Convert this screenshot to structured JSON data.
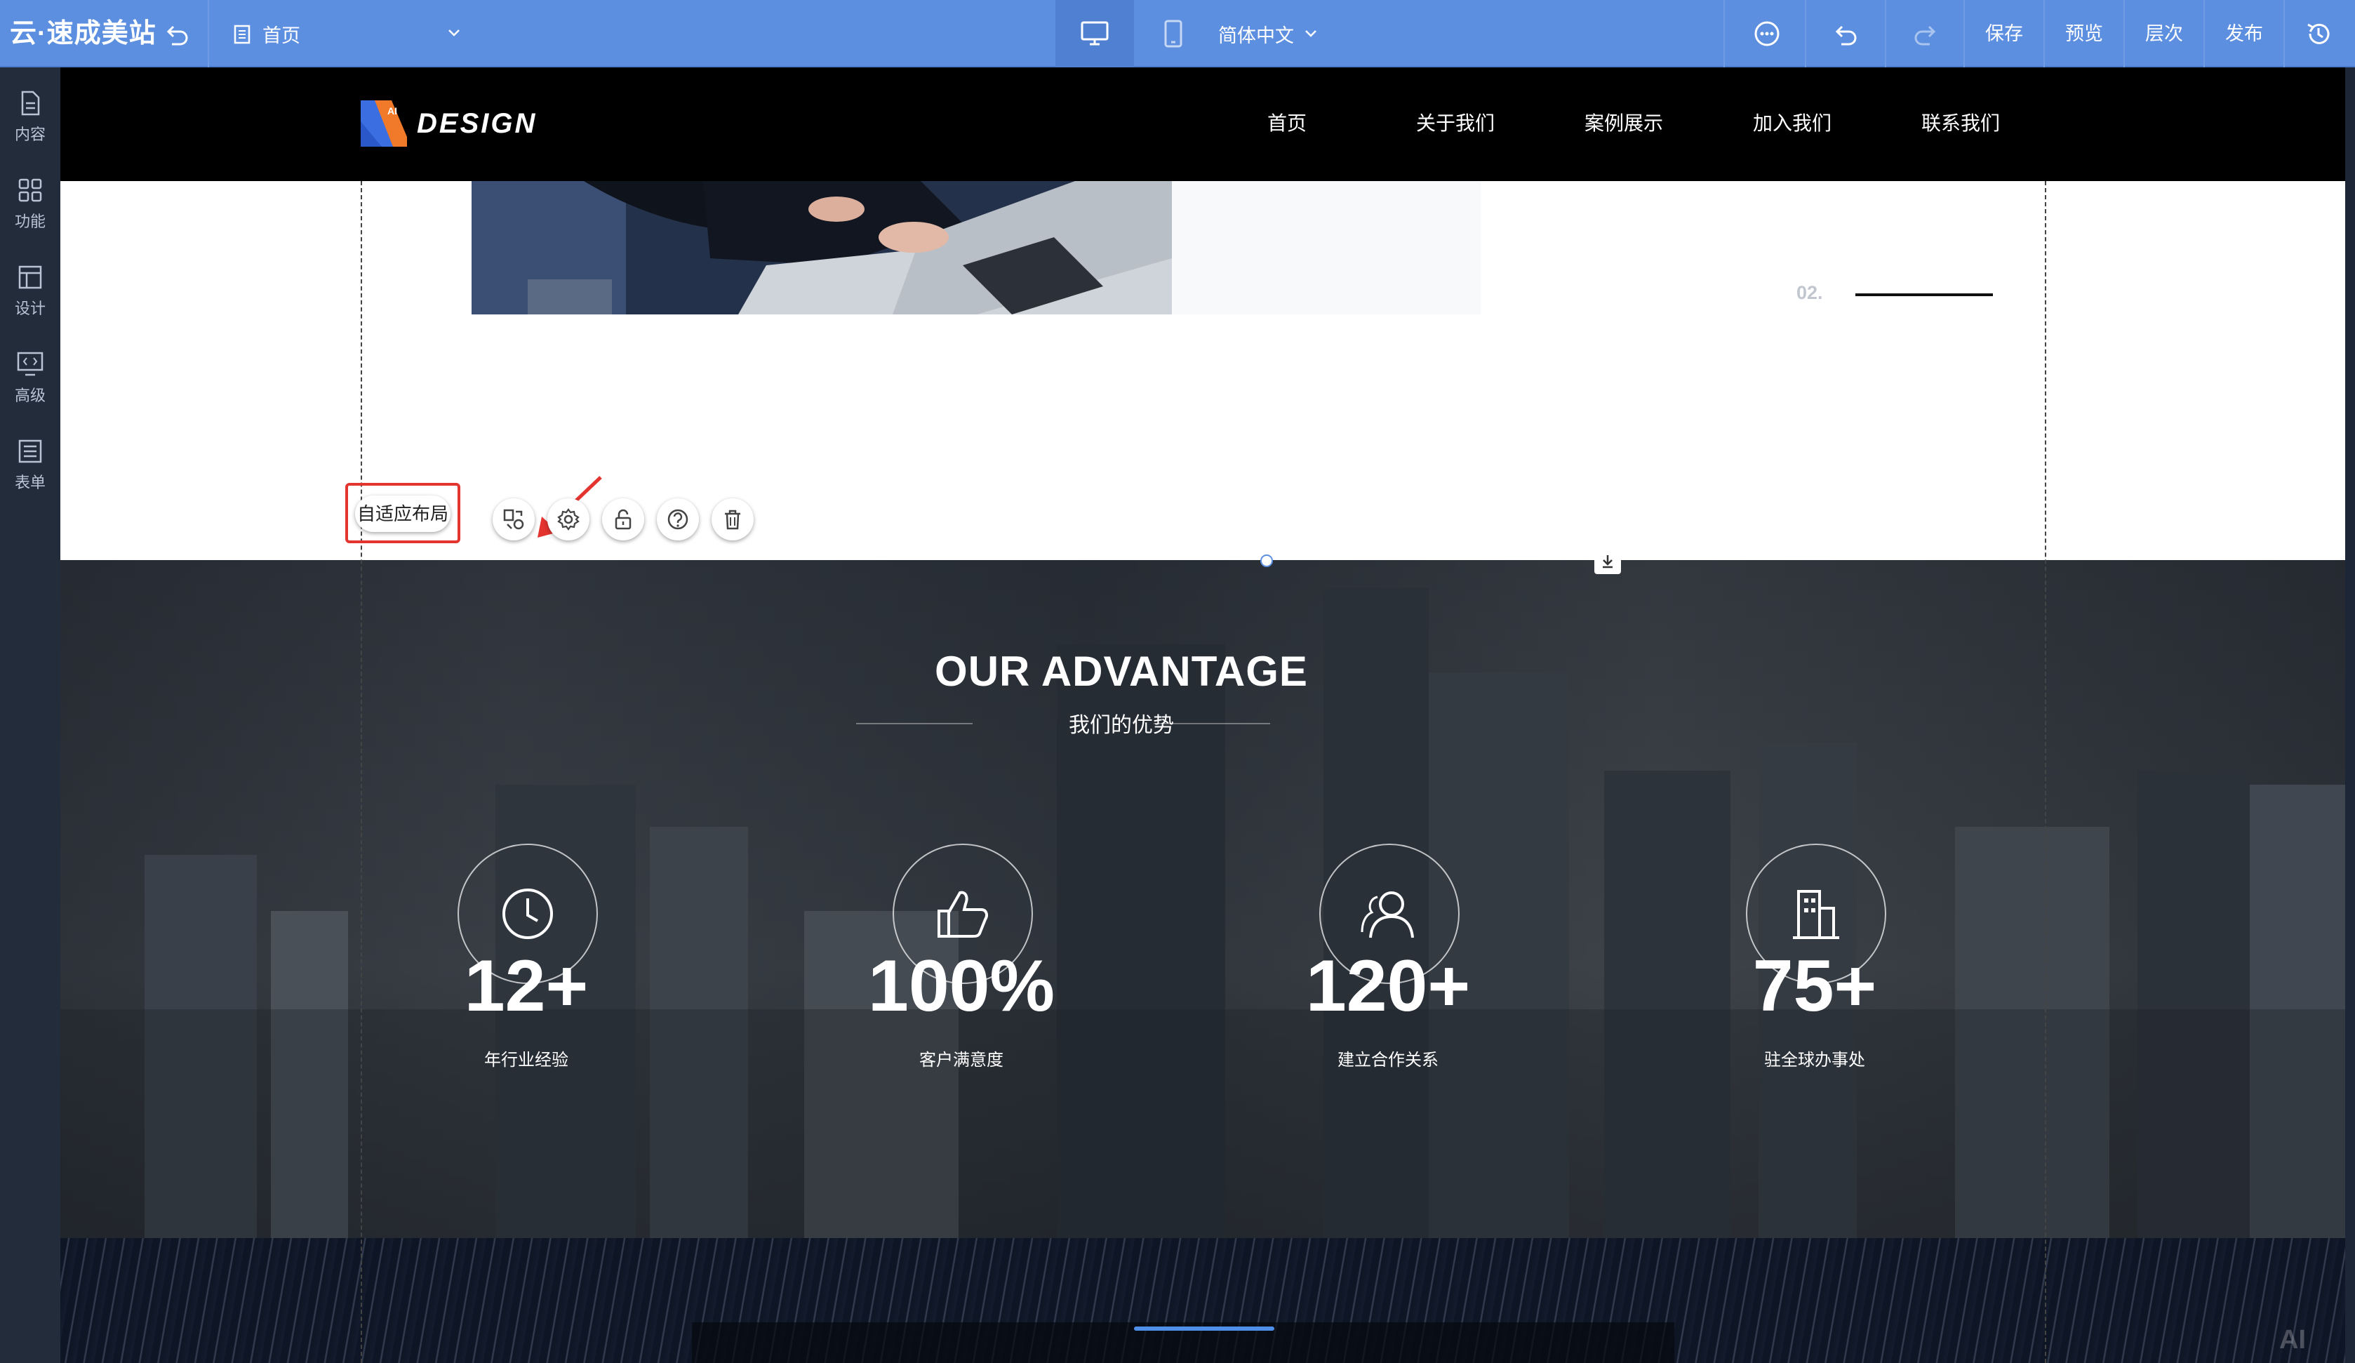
{
  "editor": {
    "brand": "云·速成美站",
    "page_select": "首页",
    "language": "简体中文",
    "actions": {
      "save": "保存",
      "preview": "预览",
      "layers": "层次",
      "publish": "发布"
    }
  },
  "sidebar": {
    "items": [
      {
        "label": "内容",
        "icon": "document-icon"
      },
      {
        "label": "功能",
        "icon": "grid-icon"
      },
      {
        "label": "设计",
        "icon": "layout-icon"
      },
      {
        "label": "高级",
        "icon": "code-monitor-icon"
      },
      {
        "label": "表单",
        "icon": "form-list-icon"
      }
    ]
  },
  "site": {
    "logo_text": "DESIGN",
    "logo_badge": "AI",
    "nav": [
      "首页",
      "关于我们",
      "案例展示",
      "加入我们",
      "联系我们"
    ],
    "slide_number": "02."
  },
  "selection_toolbar": {
    "adaptive_layout": "自适应布局",
    "buttons": [
      "replace-icon",
      "settings-icon",
      "lock-icon",
      "help-icon",
      "delete-icon"
    ]
  },
  "advantage": {
    "title": "OUR ADVANTAGE",
    "subtitle": "我们的优势",
    "stats": [
      {
        "value": "12+",
        "label": "年行业经验",
        "icon": "clock-icon"
      },
      {
        "value": "100%",
        "label": "客户满意度",
        "icon": "thumbs-up-icon"
      },
      {
        "value": "120+",
        "label": "建立合作关系",
        "icon": "people-icon"
      },
      {
        "value": "75+",
        "label": "驻全球办事处",
        "icon": "building-icon"
      }
    ]
  },
  "footer_mark": "AI",
  "colors": {
    "editor_bar": "#5d8fe0",
    "sidebar": "#222c3b",
    "highlight": "#e3342f",
    "accent_line": "#4e8fe8"
  }
}
